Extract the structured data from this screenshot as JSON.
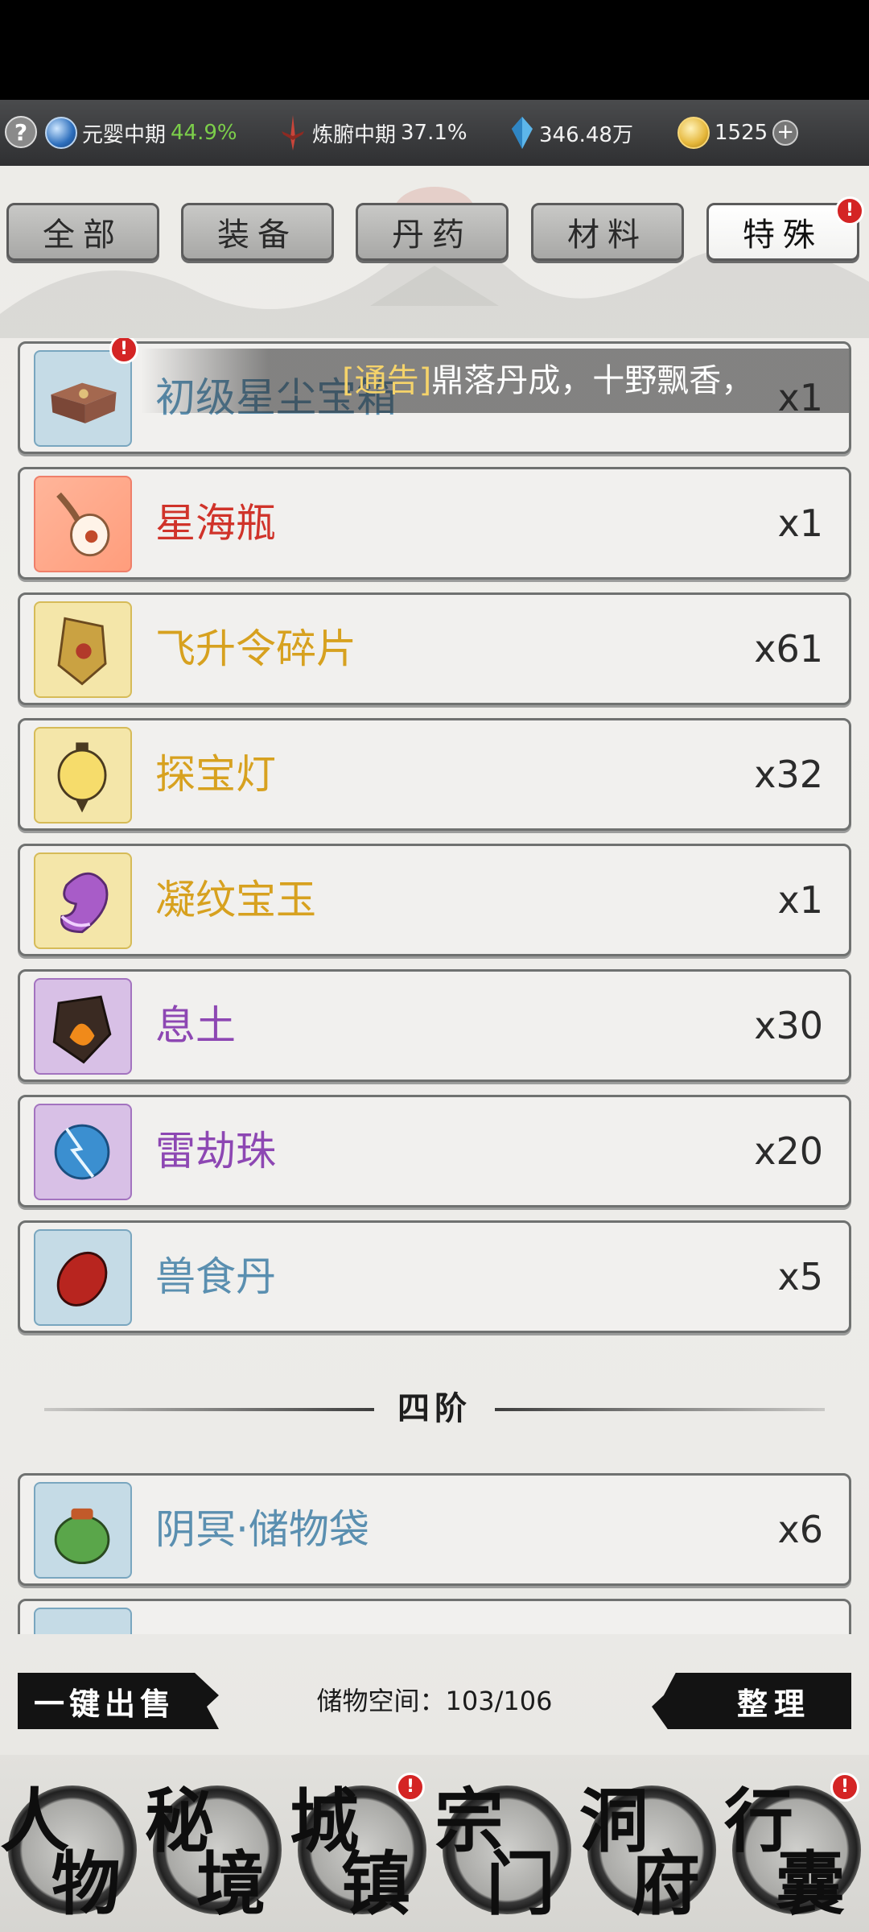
{
  "status_bar": {
    "help": "?",
    "realm": {
      "label": "元婴中期",
      "percent": "44.9%"
    },
    "body_realm": {
      "label": "炼腑中期",
      "percent": "37.1%"
    },
    "spirit_stones": "346.48万",
    "coins": "1525",
    "add": "+"
  },
  "tabs": [
    {
      "label": "全部",
      "active": false
    },
    {
      "label": "装备",
      "active": false
    },
    {
      "label": "丹药",
      "active": false
    },
    {
      "label": "材料",
      "active": false
    },
    {
      "label": "特殊",
      "active": true,
      "badge": "!"
    }
  ],
  "notice": {
    "tag": "[通告]",
    "text": "鼎落丹成，十野飘香，"
  },
  "items": [
    {
      "name": "初级星尘宝箱",
      "count": "x1",
      "rarity": "blue",
      "badge": "!"
    },
    {
      "name": "星海瓶",
      "count": "x1",
      "rarity": "red"
    },
    {
      "name": "飞升令碎片",
      "count": "x61",
      "rarity": "yellow"
    },
    {
      "name": "探宝灯",
      "count": "x32",
      "rarity": "yellow"
    },
    {
      "name": "凝纹宝玉",
      "count": "x1",
      "rarity": "yellow"
    },
    {
      "name": "息土",
      "count": "x30",
      "rarity": "purple"
    },
    {
      "name": "雷劫珠",
      "count": "x20",
      "rarity": "purple"
    },
    {
      "name": "兽食丹",
      "count": "x5",
      "rarity": "blue"
    }
  ],
  "tier_label": "四阶",
  "tier_items": [
    {
      "name": "阴冥·储物袋",
      "count": "x6",
      "rarity": "blue"
    }
  ],
  "actions": {
    "sell_all": "一键出售",
    "storage": "储物空间：103/106",
    "sort": "整理"
  },
  "nav": [
    {
      "c1": "人",
      "c2": "物"
    },
    {
      "c1": "秘",
      "c2": "境"
    },
    {
      "c1": "城",
      "c2": "镇",
      "badge": "!"
    },
    {
      "c1": "宗",
      "c2": "门"
    },
    {
      "c1": "洞",
      "c2": "府"
    },
    {
      "c1": "行",
      "c2": "囊",
      "badge": "!"
    }
  ],
  "colors": {
    "rarity_blue": "#5a8fb0",
    "rarity_red": "#d0332a",
    "rarity_yellow": "#d7a11f",
    "rarity_purple": "#8d47b3",
    "badge_red": "#d42424",
    "progress_green": "#7ccf4a"
  }
}
